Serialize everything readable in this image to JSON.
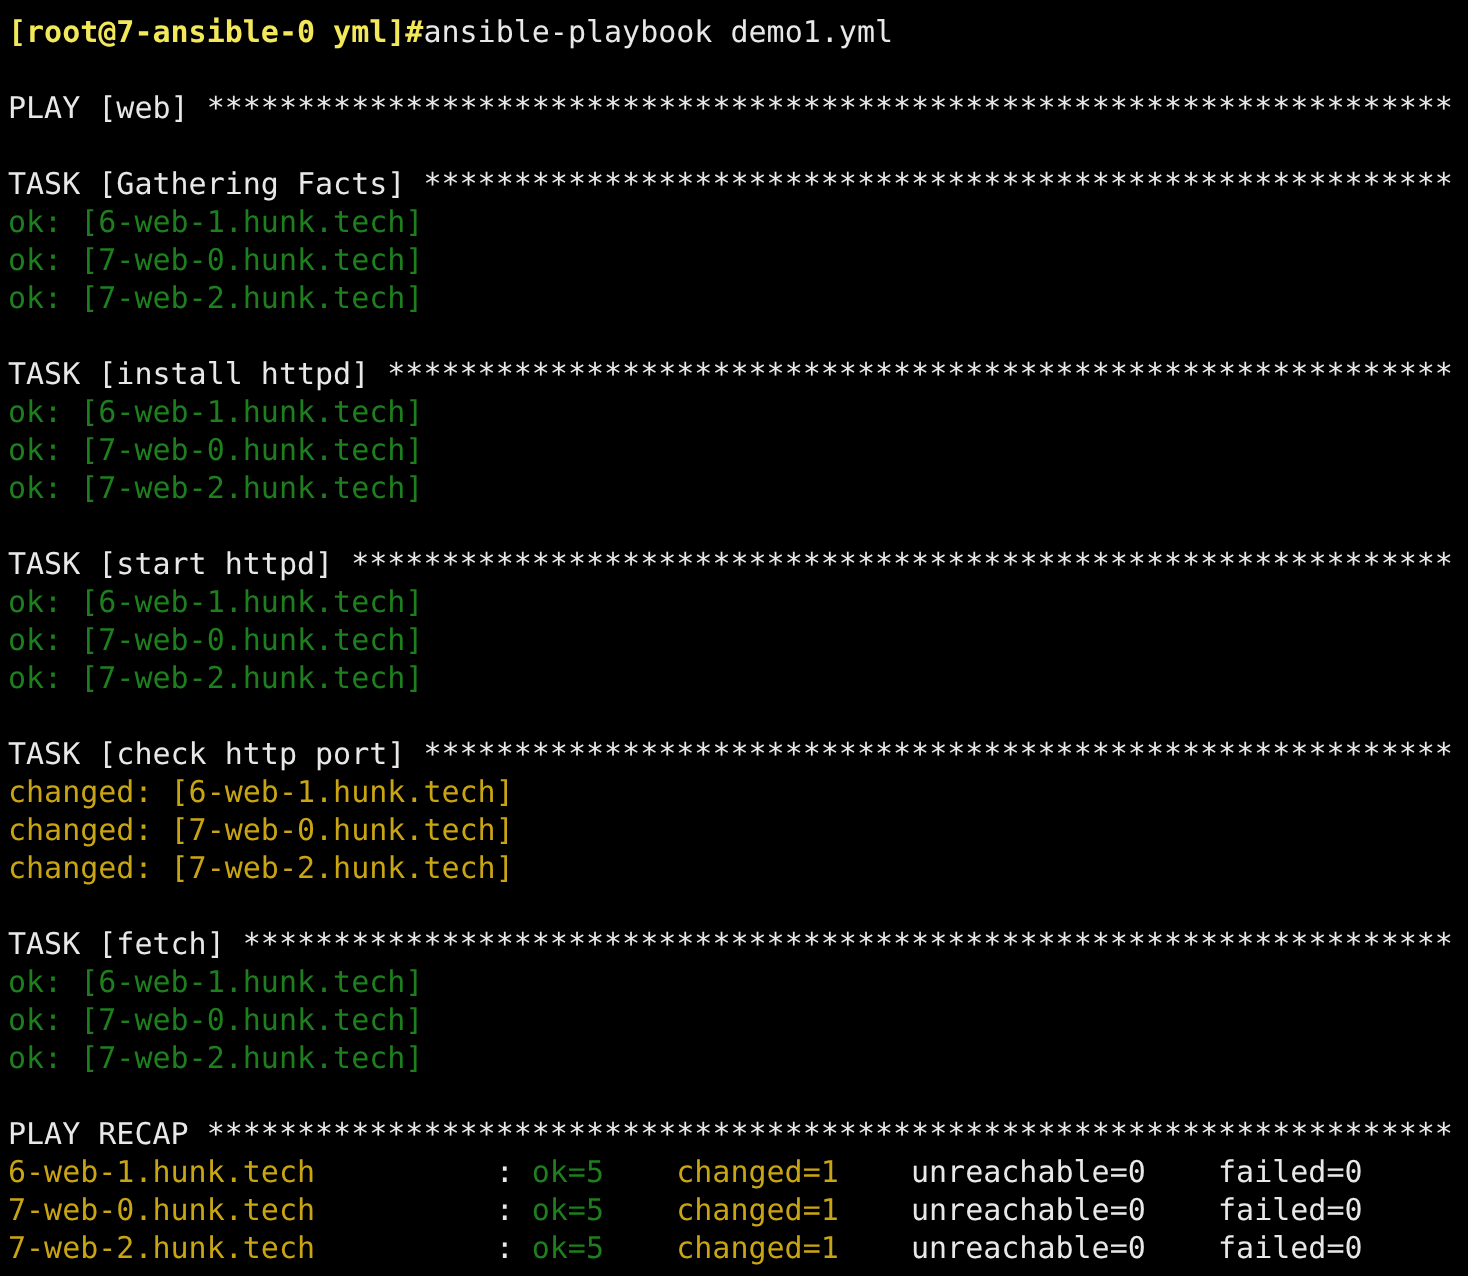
{
  "prompt": {
    "user_host": "[root@7-ansible-0 yml]#",
    "command": "ansible-playbook demo1.yml"
  },
  "blocks": [
    {
      "header": "PLAY [web] *********************************************************************"
    },
    {
      "header": "TASK [Gathering Facts] *********************************************************",
      "results": [
        {
          "kind": "ok",
          "text": "ok: [6-web-1.hunk.tech]"
        },
        {
          "kind": "ok",
          "text": "ok: [7-web-0.hunk.tech]"
        },
        {
          "kind": "ok",
          "text": "ok: [7-web-2.hunk.tech]"
        }
      ]
    },
    {
      "header": "TASK [install httpd] ***********************************************************",
      "results": [
        {
          "kind": "ok",
          "text": "ok: [6-web-1.hunk.tech]"
        },
        {
          "kind": "ok",
          "text": "ok: [7-web-0.hunk.tech]"
        },
        {
          "kind": "ok",
          "text": "ok: [7-web-2.hunk.tech]"
        }
      ]
    },
    {
      "header": "TASK [start httpd] *************************************************************",
      "results": [
        {
          "kind": "ok",
          "text": "ok: [6-web-1.hunk.tech]"
        },
        {
          "kind": "ok",
          "text": "ok: [7-web-0.hunk.tech]"
        },
        {
          "kind": "ok",
          "text": "ok: [7-web-2.hunk.tech]"
        }
      ]
    },
    {
      "header": "TASK [check http port] *********************************************************",
      "results": [
        {
          "kind": "changed",
          "text": "changed: [6-web-1.hunk.tech]"
        },
        {
          "kind": "changed",
          "text": "changed: [7-web-0.hunk.tech]"
        },
        {
          "kind": "changed",
          "text": "changed: [7-web-2.hunk.tech]"
        }
      ]
    },
    {
      "header": "TASK [fetch] *******************************************************************",
      "results": [
        {
          "kind": "ok",
          "text": "ok: [6-web-1.hunk.tech]"
        },
        {
          "kind": "ok",
          "text": "ok: [7-web-0.hunk.tech]"
        },
        {
          "kind": "ok",
          "text": "ok: [7-web-2.hunk.tech]"
        }
      ]
    }
  ],
  "recap": {
    "header": "PLAY RECAP *********************************************************************",
    "rows": [
      {
        "host": "6-web-1.hunk.tech",
        "separator": ":",
        "ok": "ok=5",
        "changed": "changed=1",
        "unreachable": "unreachable=0",
        "failed": "failed=0"
      },
      {
        "host": "7-web-0.hunk.tech",
        "separator": ":",
        "ok": "ok=5",
        "changed": "changed=1",
        "unreachable": "unreachable=0",
        "failed": "failed=0"
      },
      {
        "host": "7-web-2.hunk.tech",
        "separator": ":",
        "ok": "ok=5",
        "changed": "changed=1",
        "unreachable": "unreachable=0",
        "failed": "failed=0"
      }
    ]
  }
}
